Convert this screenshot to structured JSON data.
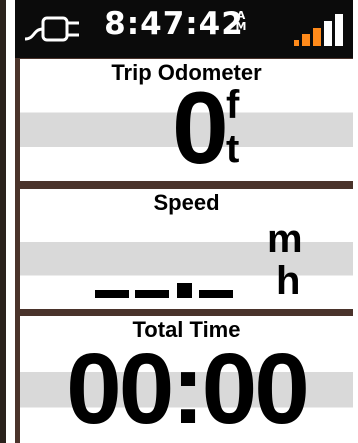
{
  "status_bar": {
    "time": "8:47:42",
    "am_pm_top": "A",
    "am_pm_bottom": "M",
    "power_icon": "ac-power-plug-icon",
    "signal_icon": "satellite-signal-bars-icon"
  },
  "fields": {
    "odometer": {
      "label": "Trip Odometer",
      "value": "0",
      "unit_top": "f",
      "unit_bottom": "t"
    },
    "speed": {
      "label": "Speed",
      "value": "__._",
      "unit_top": "m",
      "unit_bottom": "h"
    },
    "total_time": {
      "label": "Total Time",
      "value": "00:00"
    }
  },
  "colors": {
    "status_bar_bg": "#0b0b0b",
    "separator": "#4a332b",
    "field_band": "#d9d9d9",
    "signal_active": "#ff8a1a",
    "signal_inactive": "#ffffff"
  }
}
